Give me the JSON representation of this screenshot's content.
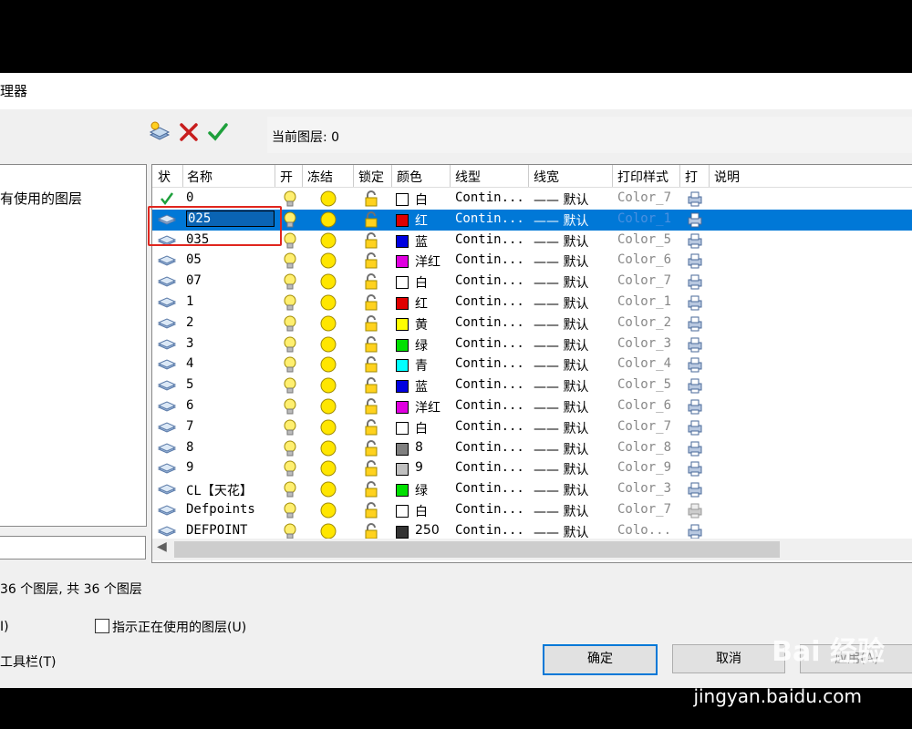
{
  "dialog": {
    "title": "理器",
    "current_layer": "当前图层: 0",
    "tree_item": "有使用的图层",
    "status_text": "36 个图层, 共 36 个图层",
    "option_invert": "I)",
    "option_indicate": "指示正在使用的图层(U)",
    "option_toolbar": "工具栏(T)",
    "ok_button": "确定",
    "cancel_button": "取消",
    "apply_button": "应用(A)"
  },
  "columns": [
    "状",
    "名称",
    "开",
    "冻结",
    "锁定",
    "颜色",
    "线型",
    "线宽",
    "打印样式",
    "打",
    "说明"
  ],
  "rows": [
    {
      "name": "0",
      "color_name": "白",
      "color": "#ffffff",
      "linetype": "Contin...",
      "lineweight": "—— 默认",
      "plot_style": "Color_7",
      "current": true
    },
    {
      "name": "025",
      "color_name": "红",
      "color": "#e00000",
      "linetype": "Contin...",
      "lineweight": "—— 默认",
      "plot_style": "Color_1",
      "selected": true
    },
    {
      "name": "035",
      "color_name": "蓝",
      "color": "#0000e0",
      "linetype": "Contin...",
      "lineweight": "—— 默认",
      "plot_style": "Color_5"
    },
    {
      "name": "05",
      "color_name": "洋红",
      "color": "#e000e0",
      "linetype": "Contin...",
      "lineweight": "—— 默认",
      "plot_style": "Color_6"
    },
    {
      "name": "07",
      "color_name": "白",
      "color": "#ffffff",
      "linetype": "Contin...",
      "lineweight": "—— 默认",
      "plot_style": "Color_7"
    },
    {
      "name": "1",
      "color_name": "红",
      "color": "#e00000",
      "linetype": "Contin...",
      "lineweight": "—— 默认",
      "plot_style": "Color_1"
    },
    {
      "name": "2",
      "color_name": "黄",
      "color": "#ffff00",
      "linetype": "Contin...",
      "lineweight": "—— 默认",
      "plot_style": "Color_2"
    },
    {
      "name": "3",
      "color_name": "绿",
      "color": "#00e000",
      "linetype": "Contin...",
      "lineweight": "—— 默认",
      "plot_style": "Color_3"
    },
    {
      "name": "4",
      "color_name": "青",
      "color": "#00ffff",
      "linetype": "Contin...",
      "lineweight": "—— 默认",
      "plot_style": "Color_4"
    },
    {
      "name": "5",
      "color_name": "蓝",
      "color": "#0000e0",
      "linetype": "Contin...",
      "lineweight": "—— 默认",
      "plot_style": "Color_5"
    },
    {
      "name": "6",
      "color_name": "洋红",
      "color": "#e000e0",
      "linetype": "Contin...",
      "lineweight": "—— 默认",
      "plot_style": "Color_6"
    },
    {
      "name": "7",
      "color_name": "白",
      "color": "#ffffff",
      "linetype": "Contin...",
      "lineweight": "—— 默认",
      "plot_style": "Color_7"
    },
    {
      "name": "8",
      "color_name": "8",
      "color": "#808080",
      "linetype": "Contin...",
      "lineweight": "—— 默认",
      "plot_style": "Color_8"
    },
    {
      "name": "9",
      "color_name": "9",
      "color": "#c0c0c0",
      "linetype": "Contin...",
      "lineweight": "—— 默认",
      "plot_style": "Color_9"
    },
    {
      "name": "CL【天花】",
      "color_name": "绿",
      "color": "#00e000",
      "linetype": "Contin...",
      "lineweight": "—— 默认",
      "plot_style": "Color_3"
    },
    {
      "name": "Defpoints",
      "color_name": "白",
      "color": "#ffffff",
      "linetype": "Contin...",
      "lineweight": "—— 默认",
      "plot_style": "Color_7",
      "no_plot": true
    },
    {
      "name": "DEFPOINT",
      "color_name": "250",
      "color": "#333333",
      "linetype": "Contin...",
      "lineweight": "—— 默认",
      "plot_style": "Colo..."
    }
  ],
  "watermark": {
    "brand": "Bai 经验",
    "url": "jingyan.baidu.com"
  }
}
